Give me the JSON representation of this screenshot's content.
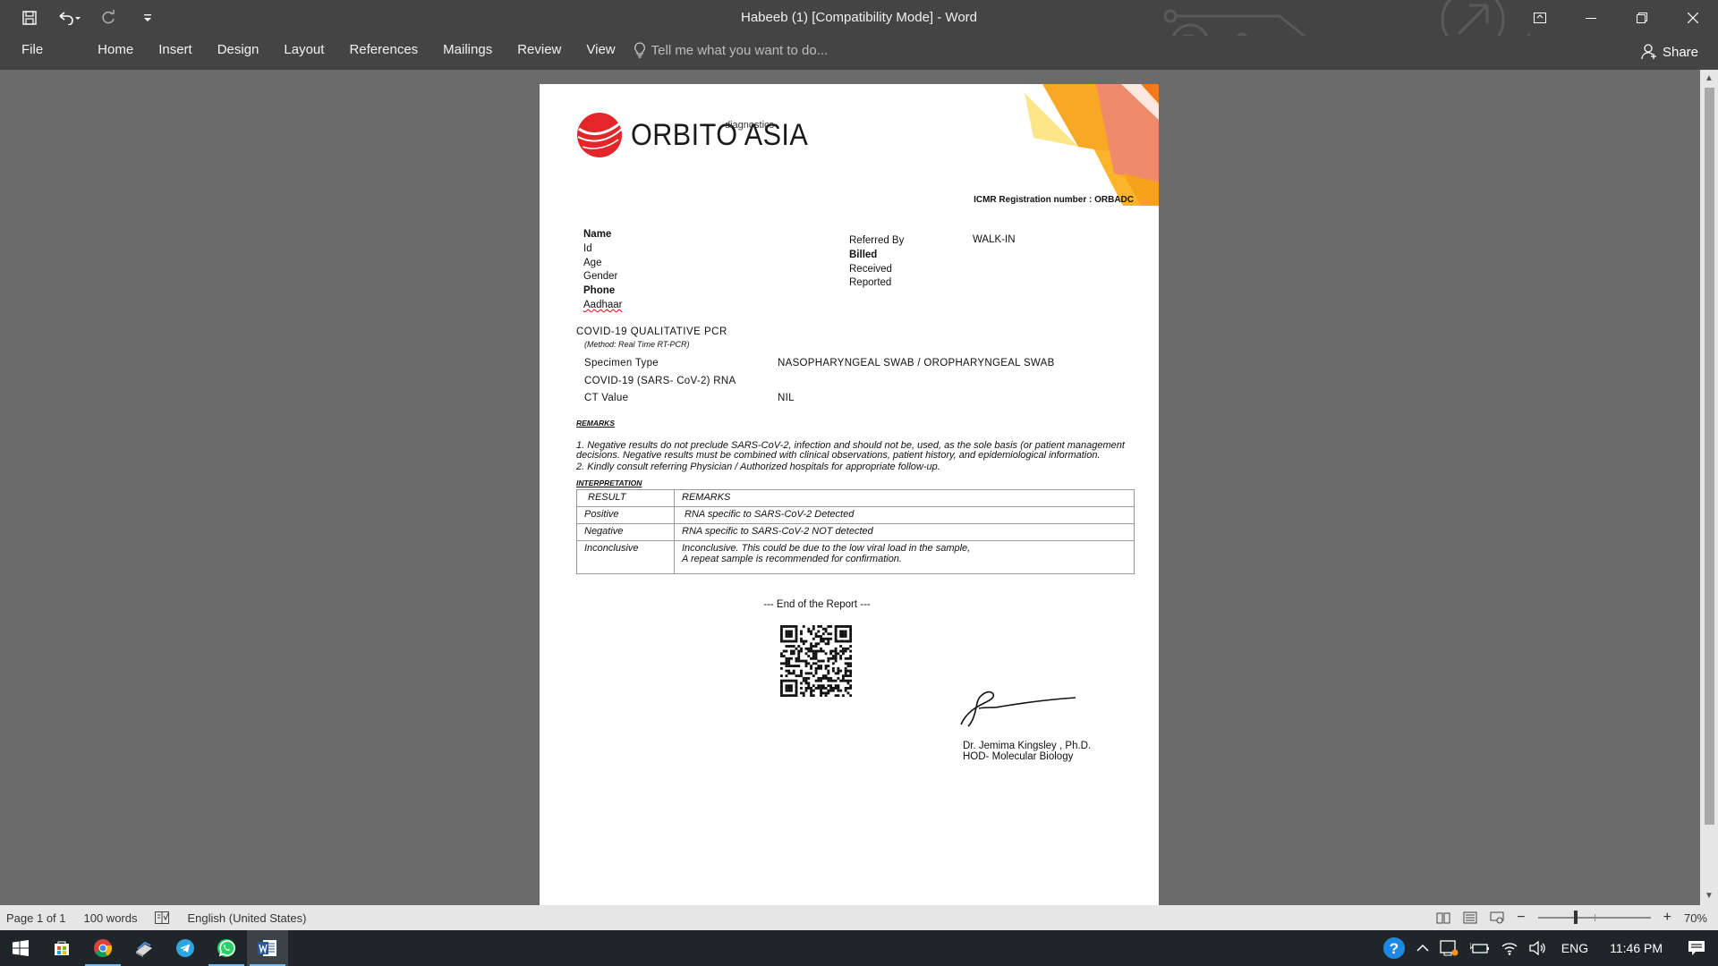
{
  "window": {
    "title": "Habeeb (1) [Compatibility Mode] - Word",
    "colors": {
      "chrome": "#444444",
      "workspace": "#6b6b6b",
      "statusbar": "#e6e6e6",
      "taskbar": "#1f2629"
    }
  },
  "quick_access": {
    "save_icon": "save-icon",
    "undo_icon": "undo-icon",
    "redo_icon": "repeat-icon",
    "customize_icon": "customize-icon"
  },
  "ribbon": {
    "tabs": [
      "File",
      "Home",
      "Insert",
      "Design",
      "Layout",
      "References",
      "Mailings",
      "Review",
      "View"
    ],
    "tell_me_placeholder": "Tell me what you want to do...",
    "share_label": "Share"
  },
  "document": {
    "logo": {
      "name": "ORBITO ASIA",
      "sub": "diagnostics"
    },
    "icmr": "ICMR Registration number : ORBADC",
    "patient_fields": [
      "Name",
      "Id",
      "Age",
      "Gender",
      "Phone",
      "Aadhaar"
    ],
    "report_fields": [
      "Referred By",
      "Billed",
      "Received",
      "Reported"
    ],
    "referred_by_value": "WALK-IN",
    "test_title": "COVID-19 QUALITATIVE PCR",
    "method": "(Method: Real Time RT-PCR)",
    "specimen": [
      {
        "label": "Specimen Type",
        "value": "NASOPHARYNGEAL SWAB / OROPHARYNGEAL SWAB"
      },
      {
        "label": "COVID-19 (SARS- CoV-2) RNA",
        "value": ""
      },
      {
        "label": "CT Value",
        "value": "NIL"
      }
    ],
    "remarks_heading": "REMARKS",
    "remarks": [
      "1. Negative results do not preclude SARS-CoV-2, infection and should not be, used, as the sole basis (or patient management decisions. Negative results must be combined with clinical observations, patient history, and epidemiological information.",
      "2. Kindly consult referring Physician / Authorized hospitals for appropriate follow-up."
    ],
    "interpretation_heading": "INTERPRETATION",
    "interpretation_table": {
      "headers": [
        "RESULT",
        "REMARKS"
      ],
      "rows": [
        [
          "Positive",
          "RNA specific to SARS-CoV-2 Detected"
        ],
        [
          "Negative",
          "RNA specific to SARS-CoV-2 NOT detected"
        ],
        [
          "Inconclusive",
          "Inconclusive. This could be due to the low viral load in the sample,\nA repeat sample is recommended for confirmation."
        ]
      ]
    },
    "end_of_report": "--- End of the Report ---",
    "signer": {
      "name": "Dr. Jemima Kingsley , Ph.D.",
      "title": "HOD- Molecular Biology"
    }
  },
  "status_bar": {
    "page": "Page 1 of 1",
    "words": "100 words",
    "language": "English (United States)",
    "zoom": "70%",
    "zoom_value": 70
  },
  "taskbar": {
    "apps": [
      "start-icon",
      "store-icon",
      "chrome-icon",
      "file-explorer-icon",
      "telegram-icon",
      "whatsapp-icon",
      "word-icon"
    ],
    "language": "ENG",
    "time": "11:46 PM"
  }
}
